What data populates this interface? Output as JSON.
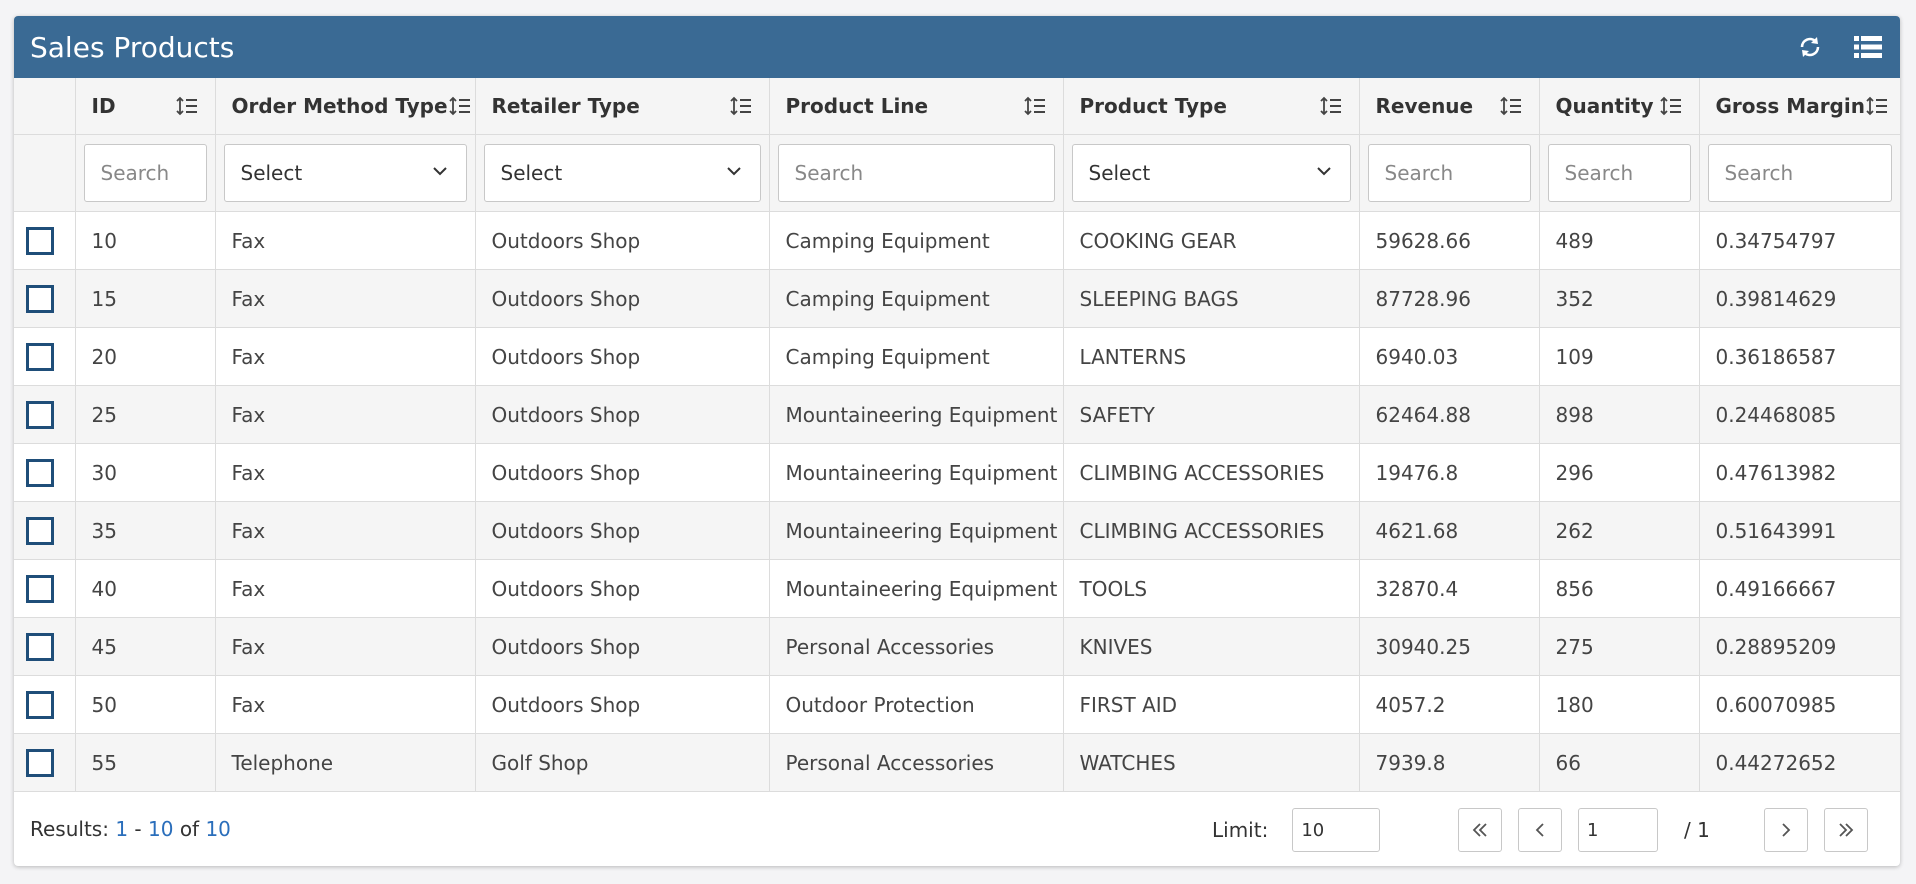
{
  "window": {
    "title": "Sales Products",
    "refresh_icon": "refresh-icon",
    "columns_icon": "list-icon"
  },
  "columns": [
    {
      "label": "ID",
      "filter": "search",
      "placeholder": "Search"
    },
    {
      "label": "Order Method Type",
      "filter": "select",
      "value": "Select"
    },
    {
      "label": "Retailer Type",
      "filter": "select",
      "value": "Select"
    },
    {
      "label": "Product Line",
      "filter": "search",
      "placeholder": "Search"
    },
    {
      "label": "Product Type",
      "filter": "select",
      "value": "Select"
    },
    {
      "label": "Revenue",
      "filter": "search",
      "placeholder": "Search"
    },
    {
      "label": "Quantity",
      "filter": "search",
      "placeholder": "Search"
    },
    {
      "label": "Gross Margin",
      "filter": "search",
      "placeholder": "Search"
    }
  ],
  "rows": [
    [
      "10",
      "Fax",
      "Outdoors Shop",
      "Camping Equipment",
      "COOKING GEAR",
      "59628.66",
      "489",
      "0.34754797"
    ],
    [
      "15",
      "Fax",
      "Outdoors Shop",
      "Camping Equipment",
      "SLEEPING BAGS",
      "87728.96",
      "352",
      "0.39814629"
    ],
    [
      "20",
      "Fax",
      "Outdoors Shop",
      "Camping Equipment",
      "LANTERNS",
      "6940.03",
      "109",
      "0.36186587"
    ],
    [
      "25",
      "Fax",
      "Outdoors Shop",
      "Mountaineering Equipment",
      "SAFETY",
      "62464.88",
      "898",
      "0.24468085"
    ],
    [
      "30",
      "Fax",
      "Outdoors Shop",
      "Mountaineering Equipment",
      "CLIMBING ACCESSORIES",
      "19476.8",
      "296",
      "0.47613982"
    ],
    [
      "35",
      "Fax",
      "Outdoors Shop",
      "Mountaineering Equipment",
      "CLIMBING ACCESSORIES",
      "4621.68",
      "262",
      "0.51643991"
    ],
    [
      "40",
      "Fax",
      "Outdoors Shop",
      "Mountaineering Equipment",
      "TOOLS",
      "32870.4",
      "856",
      "0.49166667"
    ],
    [
      "45",
      "Fax",
      "Outdoors Shop",
      "Personal Accessories",
      "KNIVES",
      "30940.25",
      "275",
      "0.28895209"
    ],
    [
      "50",
      "Fax",
      "Outdoors Shop",
      "Outdoor Protection",
      "FIRST AID",
      "4057.2",
      "180",
      "0.60070985"
    ],
    [
      "55",
      "Telephone",
      "Golf Shop",
      "Personal Accessories",
      "WATCHES",
      "7939.8",
      "66",
      "0.44272652"
    ]
  ],
  "footer": {
    "results_label": "Results:",
    "range_start": "1",
    "range_sep": "-",
    "range_end": "10",
    "of_label": "of",
    "total": "10",
    "limit_label": "Limit:",
    "limit_value": "10",
    "page_value": "1",
    "page_total": "/ 1"
  },
  "colors": {
    "header_bg": "#3a6a94",
    "checkbox_border": "#1f4e79",
    "link": "#2a6ebb"
  }
}
